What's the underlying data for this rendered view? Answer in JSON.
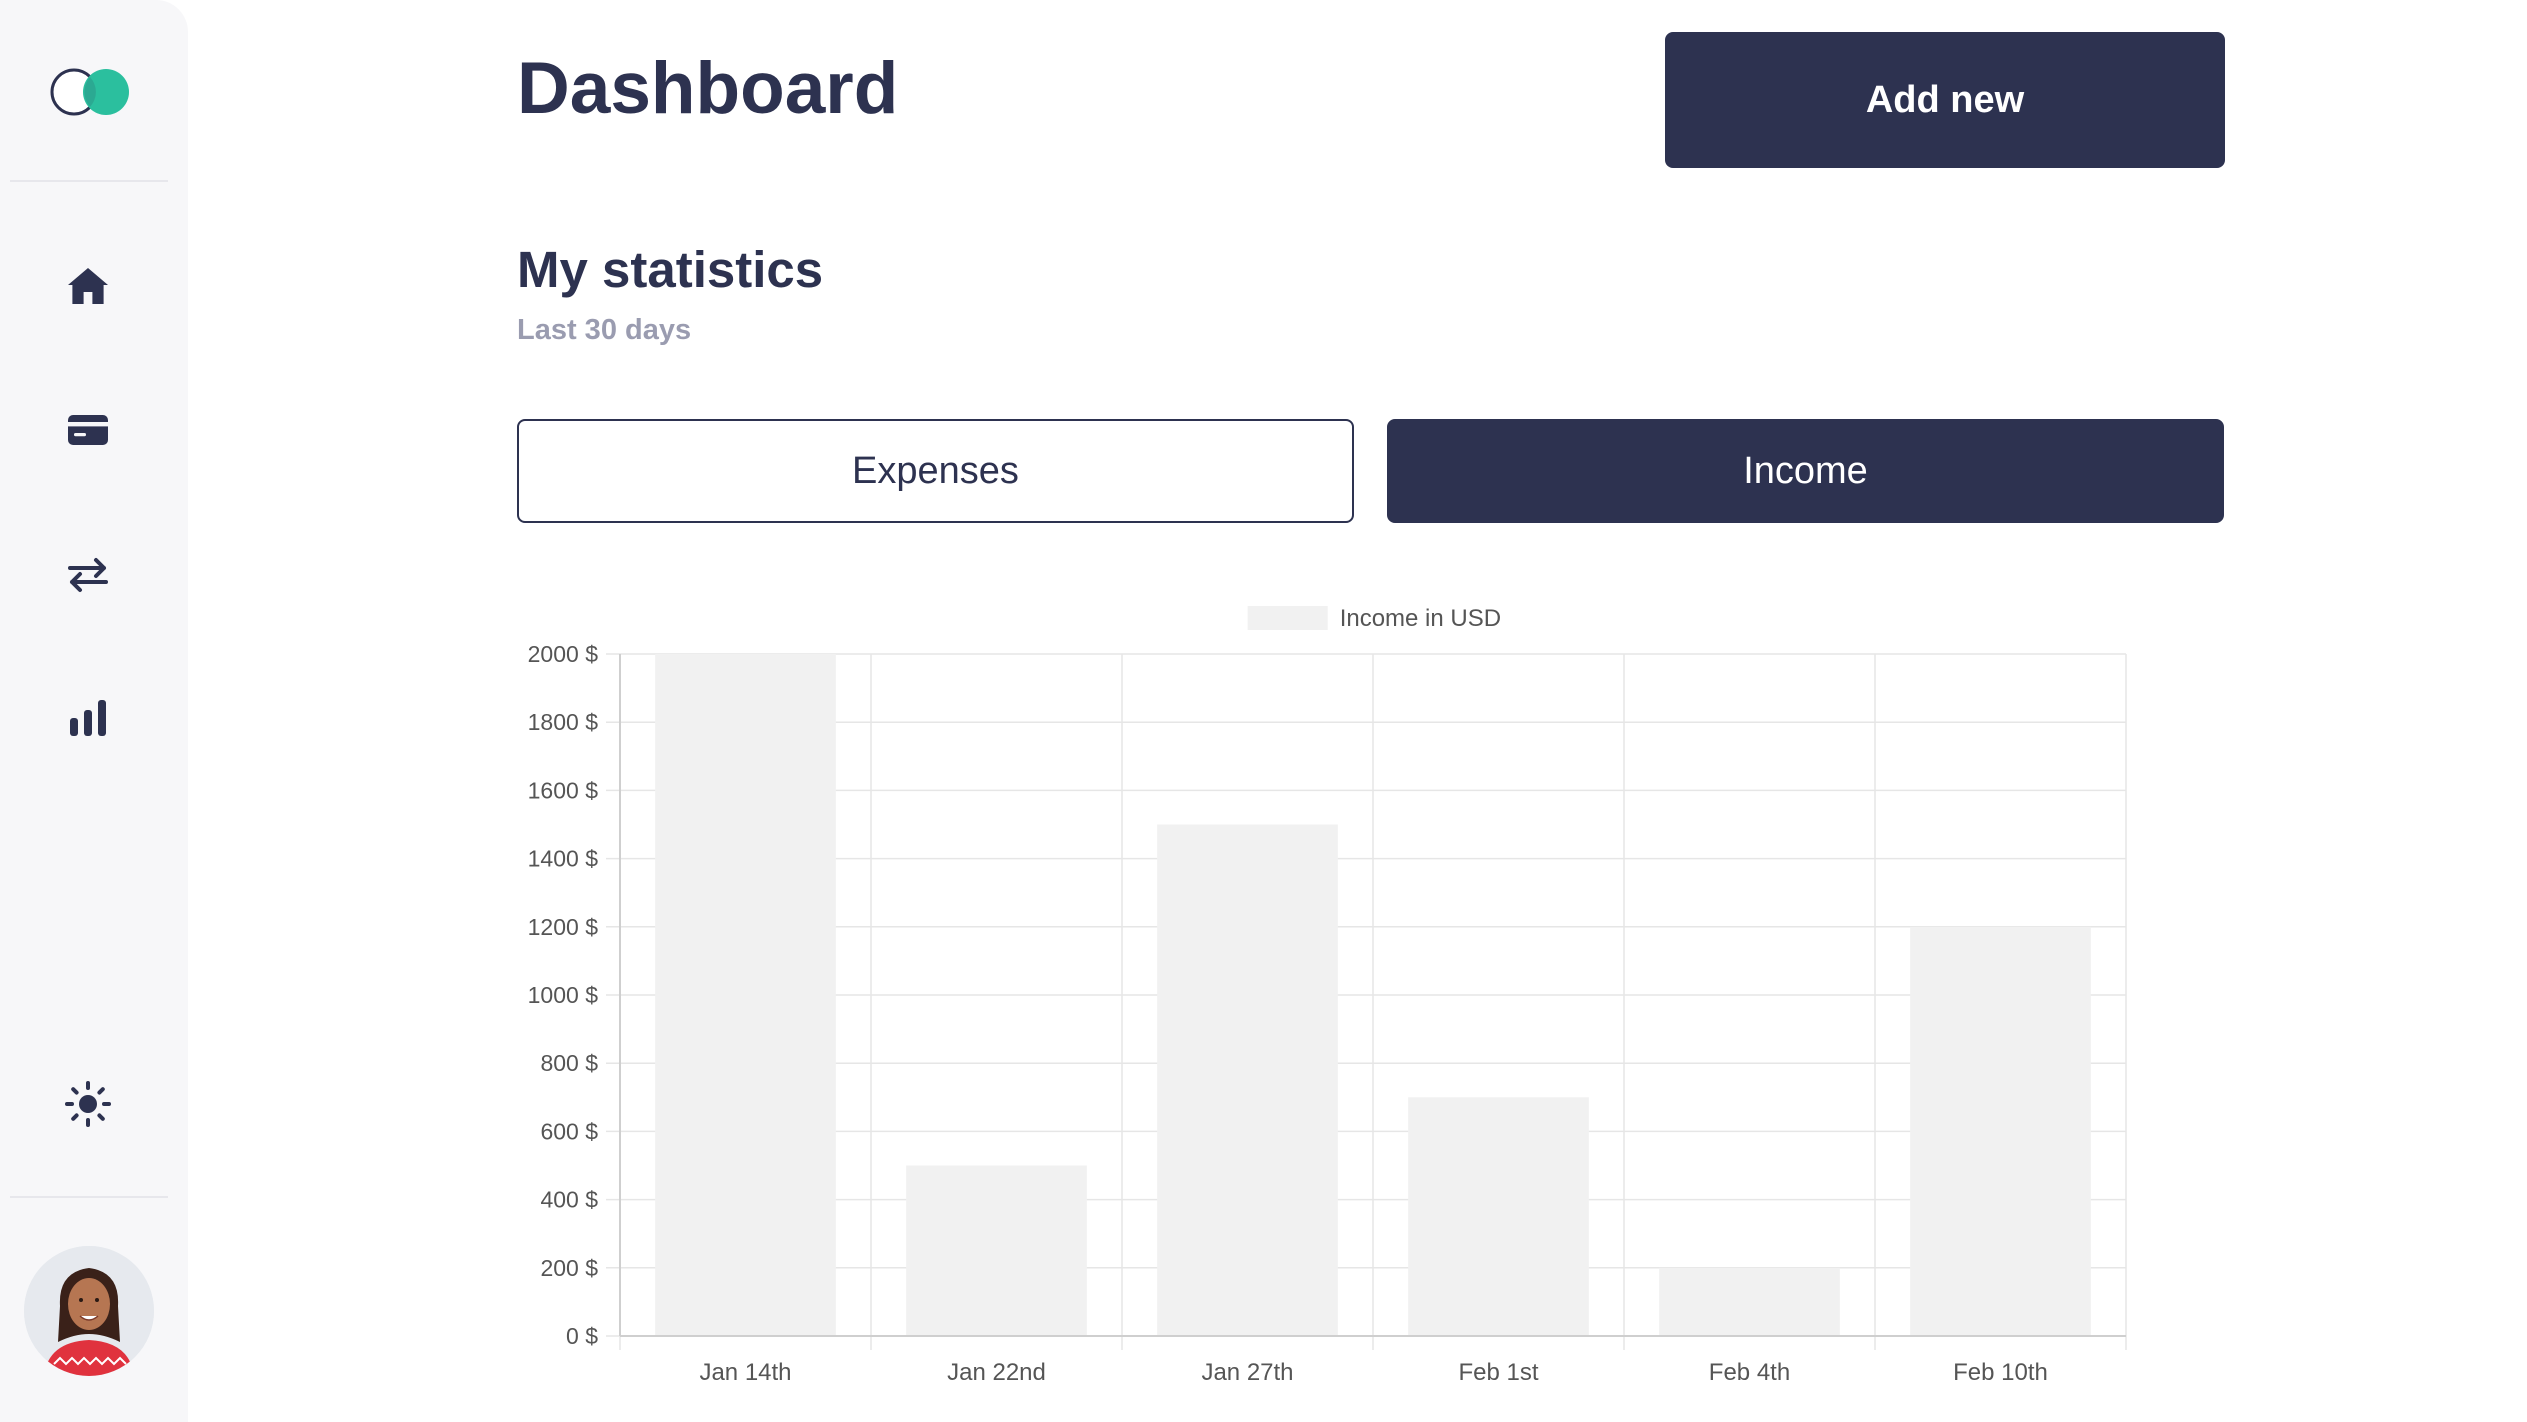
{
  "sidebar": {
    "logo_icon": "overlapping-circles-logo",
    "nav": [
      {
        "icon": "home-icon"
      },
      {
        "icon": "credit-card-icon"
      },
      {
        "icon": "transfer-arrows-icon"
      },
      {
        "icon": "bar-chart-icon"
      }
    ],
    "theme_toggle_icon": "sun-icon",
    "avatar_icon": "user-avatar"
  },
  "header": {
    "title": "Dashboard",
    "add_button_label": "Add new"
  },
  "stats": {
    "title": "My statistics",
    "subtitle": "Last 30 days",
    "tabs": [
      {
        "label": "Expenses",
        "active": false
      },
      {
        "label": "Income",
        "active": true
      }
    ]
  },
  "colors": {
    "primary": "#2d3250",
    "bar": "#f1f1f1",
    "grid": "#e6e6e6",
    "muted": "#9a9cb0"
  },
  "chart_data": {
    "type": "bar",
    "legend": "Income in USD",
    "legend_position": "top-center",
    "categories": [
      "Jan 14th",
      "Jan 22nd",
      "Jan 27th",
      "Feb 1st",
      "Feb 4th",
      "Feb 10th"
    ],
    "values": [
      2000,
      500,
      1500,
      700,
      200,
      1200
    ],
    "ylim": [
      0,
      2000
    ],
    "y_ticks": [
      0,
      200,
      400,
      600,
      800,
      1000,
      1200,
      1400,
      1600,
      1800,
      2000
    ],
    "y_tick_suffix": " $",
    "grid": true
  }
}
